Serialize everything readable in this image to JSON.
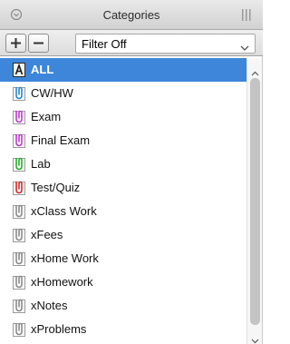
{
  "window": {
    "title": "Categories"
  },
  "toolbar": {
    "add_label": "+",
    "remove_label": "−",
    "filter_value": "Filter Off"
  },
  "categories": [
    {
      "label": "ALL",
      "icon": "all-category-icon",
      "color": "#1a1a1a",
      "selected": true
    },
    {
      "label": "CW/HW",
      "icon": "clip-icon",
      "color": "#2a86c9"
    },
    {
      "label": "Exam",
      "icon": "clip-icon",
      "color": "#c03ad0"
    },
    {
      "label": "Final Exam",
      "icon": "clip-icon",
      "color": "#c03ad0"
    },
    {
      "label": "Lab",
      "icon": "clip-icon",
      "color": "#22b02a"
    },
    {
      "label": "Test/Quiz",
      "icon": "clip-icon",
      "color": "#d62828"
    },
    {
      "label": "xClass Work",
      "icon": "clip-icon",
      "color": "#8a8a8a"
    },
    {
      "label": "xFees",
      "icon": "clip-icon",
      "color": "#8a8a8a"
    },
    {
      "label": "xHome Work",
      "icon": "clip-icon",
      "color": "#8a8a8a"
    },
    {
      "label": "xHomework",
      "icon": "clip-icon",
      "color": "#8a8a8a"
    },
    {
      "label": "xNotes",
      "icon": "clip-icon",
      "color": "#8a8a8a"
    },
    {
      "label": "xProblems",
      "icon": "clip-icon",
      "color": "#8a8a8a"
    }
  ],
  "colors": {
    "selection": "#3d86d9",
    "titlebar": "#dedede"
  }
}
